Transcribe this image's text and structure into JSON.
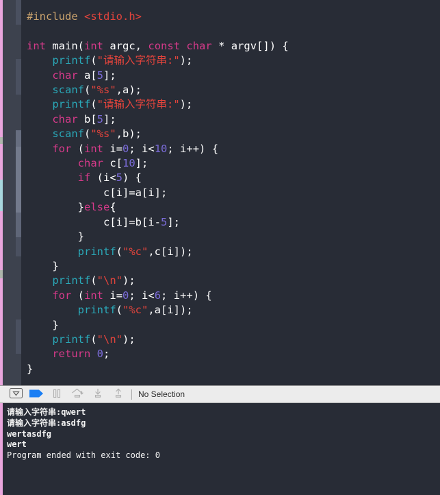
{
  "window": {
    "app": "Xcode",
    "theme_background": "#282c36",
    "accent": "#1a7ef4"
  },
  "editor": {
    "language": "c",
    "gutter_color": "#3d424e",
    "vcs_strip_color": "#e9a6dd",
    "code_lines": [
      {
        "id": 1,
        "text": "#include <stdio.h>"
      },
      {
        "id": 2,
        "text": ""
      },
      {
        "id": 3,
        "text": "int main(int argc, const char * argv[]) {"
      },
      {
        "id": 4,
        "text": "    printf(\"请输入字符串:\");"
      },
      {
        "id": 5,
        "text": "    char a[5];"
      },
      {
        "id": 6,
        "text": "    scanf(\"%s\",a);"
      },
      {
        "id": 7,
        "text": "    printf(\"请输入字符串:\");"
      },
      {
        "id": 8,
        "text": "    char b[5];"
      },
      {
        "id": 9,
        "text": "    scanf(\"%s\",b);"
      },
      {
        "id": 10,
        "text": "    for (int i=0; i<10; i++) {"
      },
      {
        "id": 11,
        "text": "        char c[10];"
      },
      {
        "id": 12,
        "text": "        if (i<5) {"
      },
      {
        "id": 13,
        "text": "            c[i]=a[i];"
      },
      {
        "id": 14,
        "text": "        }else{"
      },
      {
        "id": 15,
        "text": "            c[i]=b[i-5];"
      },
      {
        "id": 16,
        "text": "        }"
      },
      {
        "id": 17,
        "text": "        printf(\"%c\",c[i]);"
      },
      {
        "id": 18,
        "text": "    }"
      },
      {
        "id": 19,
        "text": "    printf(\"\\n\");"
      },
      {
        "id": 20,
        "text": "    for (int i=0; i<6; i++) {"
      },
      {
        "id": 21,
        "text": "        printf(\"%c\",a[i]);"
      },
      {
        "id": 22,
        "text": "    }"
      },
      {
        "id": 23,
        "text": "    printf(\"\\n\");"
      },
      {
        "id": 24,
        "text": "    return 0;"
      },
      {
        "id": 25,
        "text": "}"
      }
    ],
    "syntax_colors": {
      "preprocessor": "#c9a26d",
      "header": "#e3443c",
      "keyword": "#d63a8a",
      "function": "#2aa8b8",
      "string": "#e3443c",
      "number": "#7b6cd9",
      "plain": "#ffffff"
    }
  },
  "toolbar": {
    "background": "#ececec",
    "buttons": [
      {
        "name": "toggle-debug-area",
        "icon": "disclosure-box-icon",
        "enabled": true,
        "active": false
      },
      {
        "name": "continue",
        "icon": "continue-flag-icon",
        "enabled": true,
        "active": true
      },
      {
        "name": "pause",
        "icon": "pause-icon",
        "enabled": false,
        "active": false
      },
      {
        "name": "step-over",
        "icon": "step-over-icon",
        "enabled": false,
        "active": false
      },
      {
        "name": "step-into",
        "icon": "step-into-icon",
        "enabled": false,
        "active": false
      },
      {
        "name": "step-out",
        "icon": "step-out-icon",
        "enabled": false,
        "active": false
      }
    ],
    "selection_label": "No Selection",
    "continue_icon_color": "#1a7ef4",
    "disabled_icon_color": "#b0b0b0"
  },
  "console": {
    "strip_color": "#e9a6dd",
    "lines": [
      {
        "text": "请输入字符串:qwert",
        "bold": true
      },
      {
        "text": "请输入字符串:asdfg",
        "bold": true
      },
      {
        "text": "wertasdfg",
        "bold": true
      },
      {
        "text": "wert",
        "bold": true
      },
      {
        "text": "Program ended with exit code: 0",
        "bold": false
      }
    ]
  }
}
